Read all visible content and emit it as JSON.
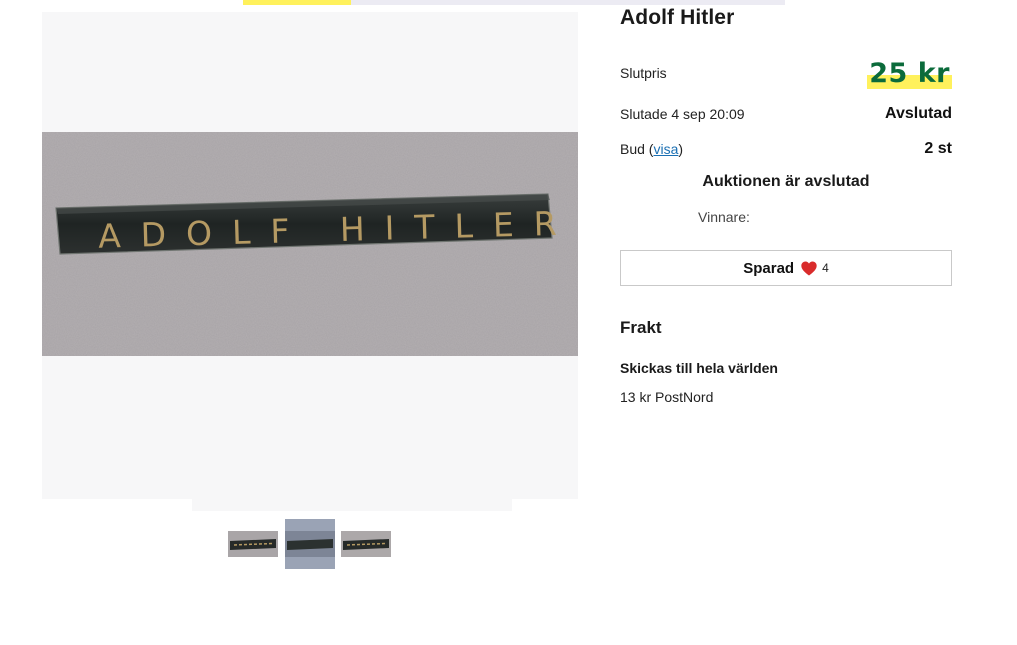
{
  "progress": {
    "fraction": 0.2
  },
  "item": {
    "title": "Adolf Hitler",
    "photo_text": "ADOLF HITLER"
  },
  "price": {
    "label": "Slutpris",
    "value": "25 kr",
    "color": "#0b6b3b",
    "highlight": "#fff15c"
  },
  "ended": {
    "label": "Slutade 4 sep 20:09",
    "status": "Avslutad"
  },
  "bids": {
    "prefix": "Bud (",
    "link": "visa",
    "suffix": ")",
    "count": "2 st"
  },
  "auction_message": "Auktionen är avslutad",
  "winner_label": "Vinnare:",
  "save": {
    "label": "Sparad",
    "count": "4",
    "icon": "heart-icon",
    "icon_color": "#d92b2b"
  },
  "shipping": {
    "heading": "Frakt",
    "title": "Skickas till hela världen",
    "option": "13 kr PostNord"
  },
  "thumbnails": {
    "count": 3,
    "active_index": 1
  }
}
